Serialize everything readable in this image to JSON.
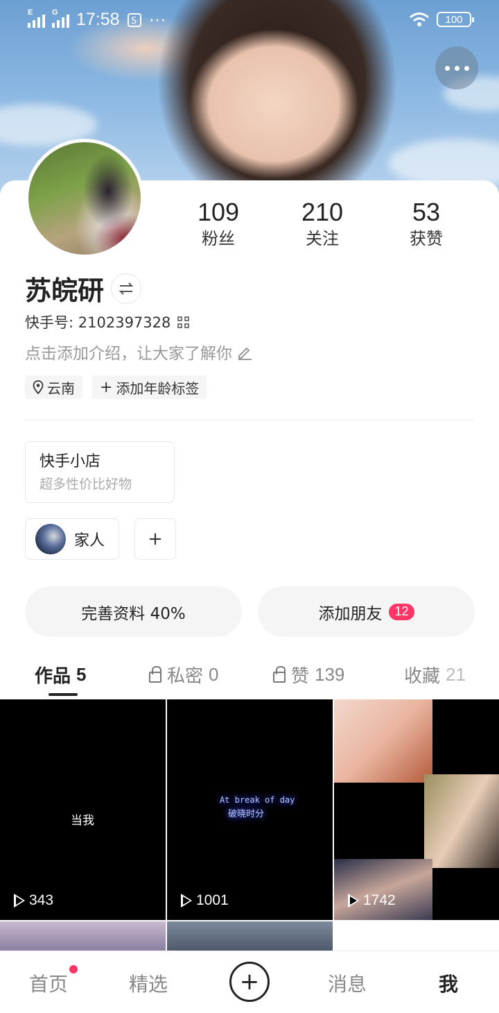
{
  "status_bar": {
    "time": "17:58",
    "signal1_label": "E",
    "signal2_label": "G",
    "more_dots": "···",
    "battery": "100"
  },
  "profile": {
    "name": "苏皖研",
    "kuaishou_id_label": "快手号: ",
    "kuaishou_id": "2102397328",
    "intro_placeholder": "点击添加介绍，让大家了解你",
    "location": "云南",
    "add_age_tag": "添加年龄标签"
  },
  "stats": [
    {
      "value": "109",
      "label": "粉丝"
    },
    {
      "value": "210",
      "label": "关注"
    },
    {
      "value": "53",
      "label": "获赞"
    }
  ],
  "shop": {
    "title": "快手小店",
    "subtitle": "超多性价比好物"
  },
  "group": {
    "label": "家人",
    "add": "+"
  },
  "actions": {
    "complete_profile": "完善资料 40%",
    "add_friends": "添加朋友",
    "add_friends_badge": "12"
  },
  "tabs": [
    {
      "label": "作品",
      "count": "5"
    },
    {
      "label": "私密",
      "count": "0"
    },
    {
      "label": "赞",
      "count": "139"
    },
    {
      "label": "收藏",
      "count": "21"
    }
  ],
  "videos": [
    {
      "plays": "343",
      "caption": "当我"
    },
    {
      "plays": "1001",
      "caption_en": "At break of day",
      "caption_cn": "破晓时分"
    },
    {
      "plays": "1742"
    }
  ],
  "bottom_nav": {
    "home": "首页",
    "featured": "精选",
    "plus": "+",
    "messages": "消息",
    "me": "我"
  }
}
